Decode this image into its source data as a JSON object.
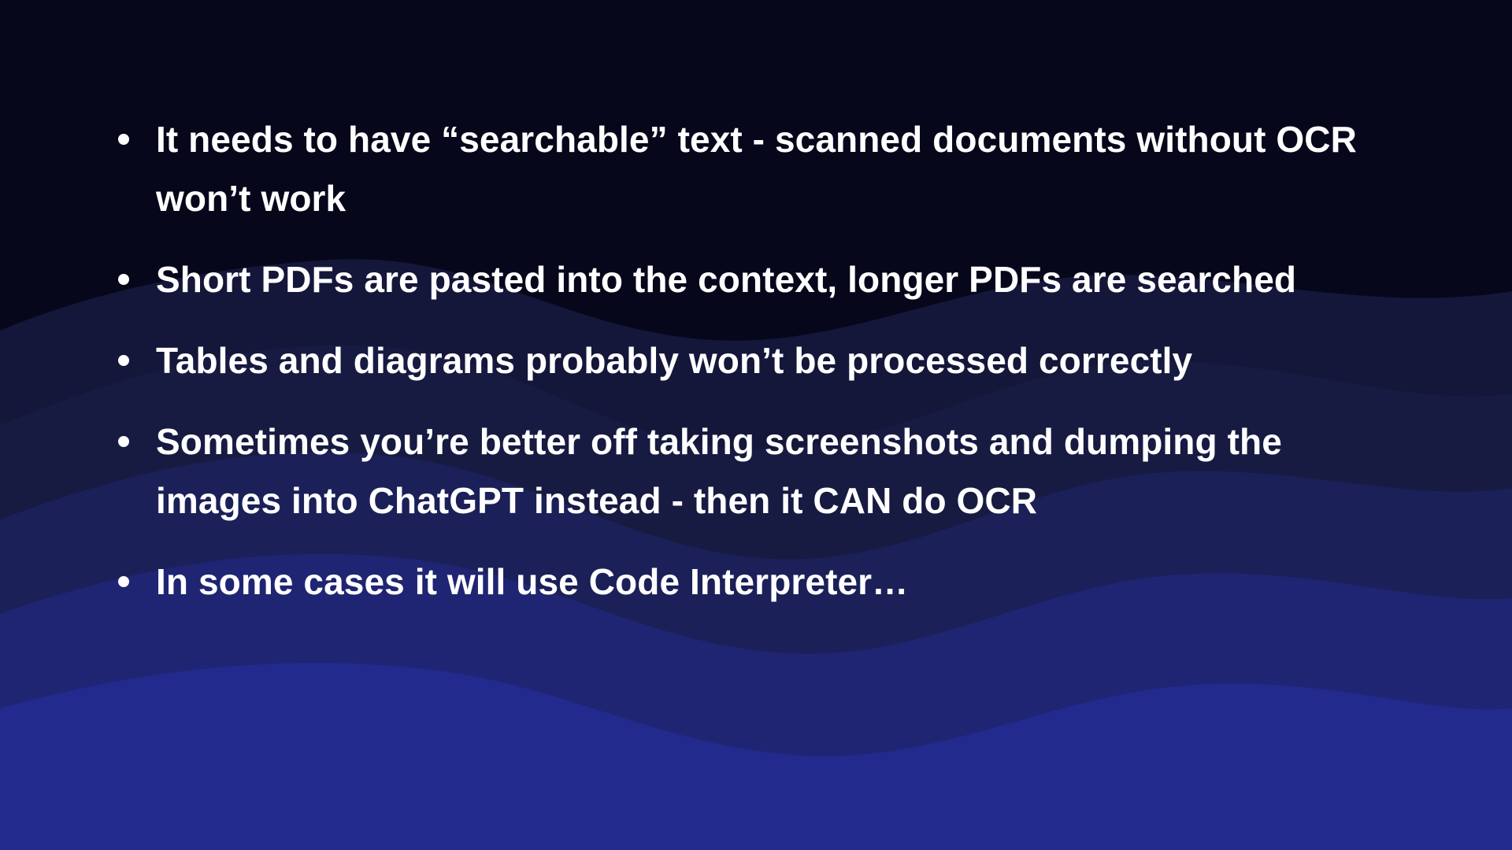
{
  "bullets": [
    "It needs to have “searchable” text - scanned documents without OCR won’t work",
    "Short PDFs are pasted into the context, longer PDFs are searched",
    "Tables and diagrams probably won’t be processed correctly",
    "Sometimes you’re better off taking screenshots and dumping the images into ChatGPT instead - then it CAN do OCR",
    "In some cases it will use Code Interpreter…"
  ],
  "colors": {
    "background_top": "#07071c",
    "wave1": "#171b42",
    "wave2": "#1b2058",
    "wave3": "#1f2572",
    "wave4": "#222a8e",
    "text": "#ffffff"
  }
}
